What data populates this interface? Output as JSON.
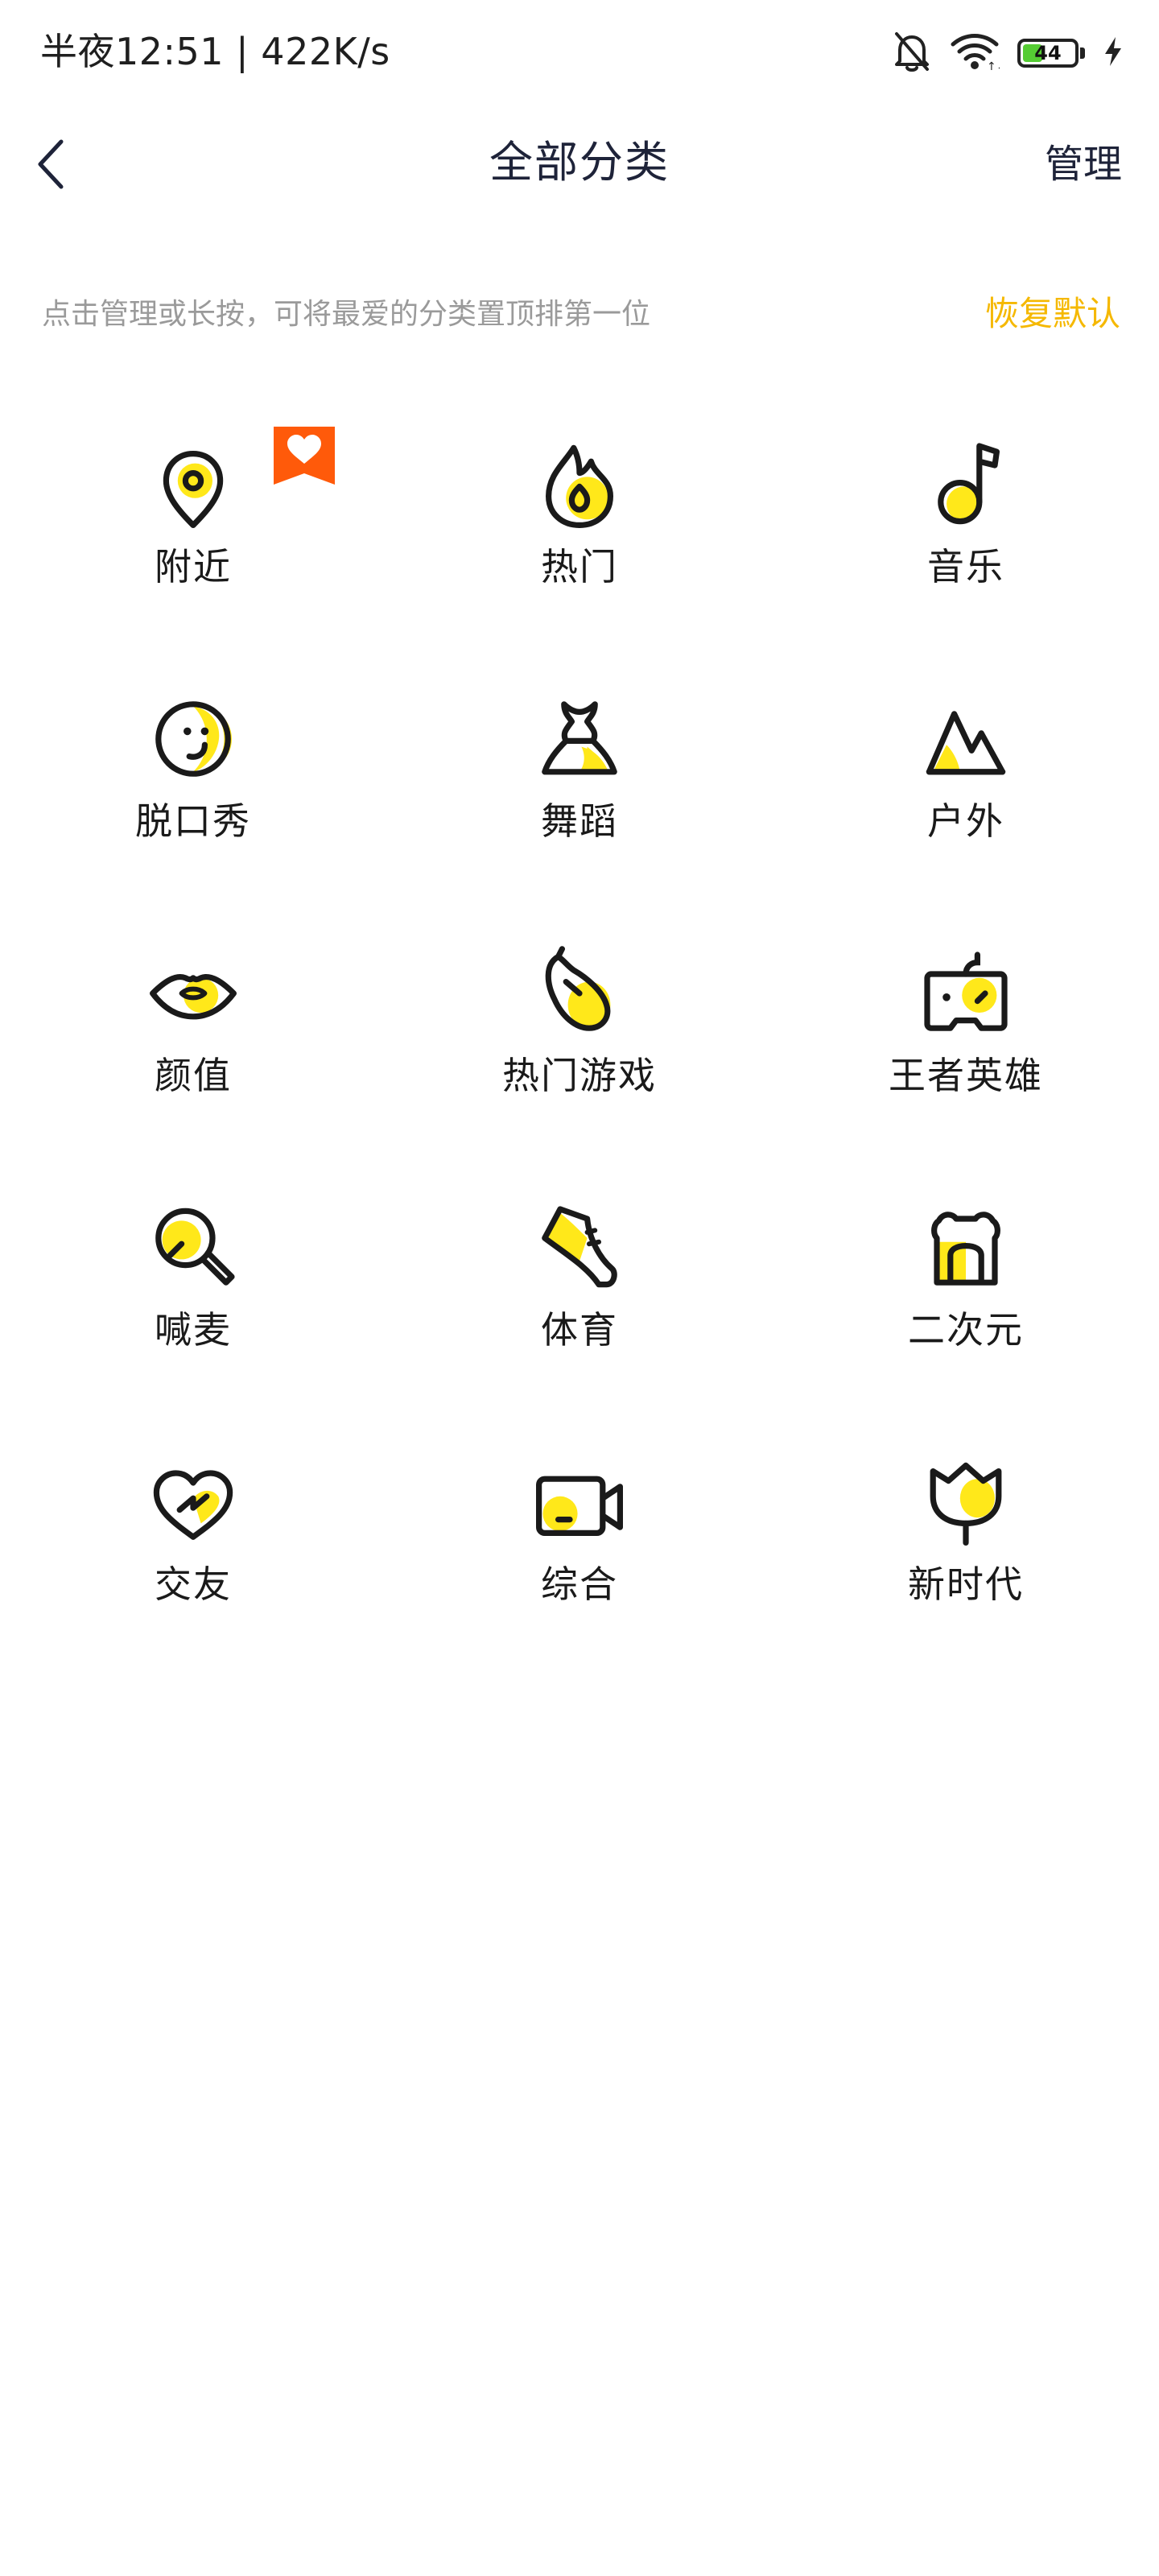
{
  "status_bar": {
    "time_speed": "半夜12:51 | 422K/s",
    "battery_level": "44",
    "battery_percent": 44,
    "icons": [
      "bell-off-icon",
      "wifi-icon",
      "battery-icon",
      "charging-icon"
    ]
  },
  "header": {
    "back_icon": "chevron-left-icon",
    "title": "全部分类",
    "manage_label": "管理"
  },
  "hint": {
    "text": "点击管理或长按，可将最爱的分类置顶排第一位",
    "restore_label": "恢复默认"
  },
  "colors": {
    "accent_yellow": "#ffe81a",
    "restore_text": "#f5b800",
    "favorite_badge": "#ff5a0a",
    "icon_stroke": "#1a1a1a"
  },
  "categories": [
    {
      "label": "附近",
      "icon": "location-pin-icon",
      "favorite": true
    },
    {
      "label": "热门",
      "icon": "flame-icon"
    },
    {
      "label": "音乐",
      "icon": "music-note-icon"
    },
    {
      "label": "脱口秀",
      "icon": "smiley-icon"
    },
    {
      "label": "舞蹈",
      "icon": "dress-icon"
    },
    {
      "label": "户外",
      "icon": "mountain-icon"
    },
    {
      "label": "颜值",
      "icon": "lips-icon"
    },
    {
      "label": "热门游戏",
      "icon": "mouse-icon"
    },
    {
      "label": "王者英雄",
      "icon": "gamepad-icon"
    },
    {
      "label": "喊麦",
      "icon": "microphone-icon"
    },
    {
      "label": "体育",
      "icon": "sneaker-icon"
    },
    {
      "label": "二次元",
      "icon": "bear-icon"
    },
    {
      "label": "交友",
      "icon": "heart-icon"
    },
    {
      "label": "综合",
      "icon": "video-camera-icon"
    },
    {
      "label": "新时代",
      "icon": "tulip-icon"
    }
  ]
}
